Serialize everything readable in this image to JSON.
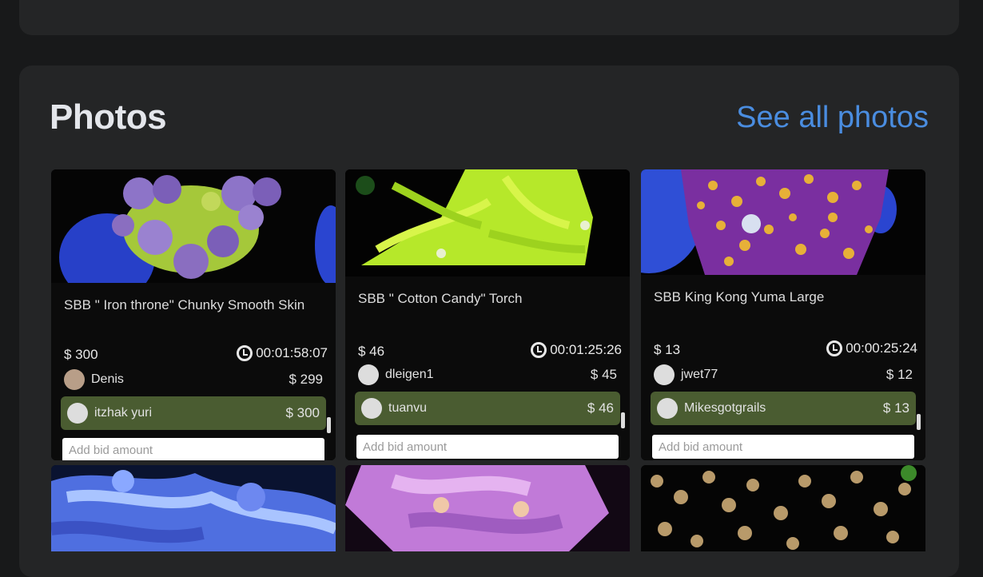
{
  "photos": {
    "title": "Photos",
    "see_all_label": "See all photos"
  },
  "listings": [
    {
      "title": "SBB \" Iron throne\" Chunky Smooth Skin",
      "price": "$ 300",
      "timer": "00:01:58:07",
      "prev_bidder": "Denis",
      "prev_bid": "$ 299",
      "top_bidder": "itzhak yuri",
      "top_bid": "$ 300",
      "bid_placeholder": "Add bid amount"
    },
    {
      "title": "SBB \" Cotton Candy\" Torch",
      "price": "$ 46",
      "timer": "00:01:25:26",
      "prev_bidder": "dleigen1",
      "prev_bid": "$ 45",
      "top_bidder": "tuanvu",
      "top_bid": "$ 46",
      "bid_placeholder": "Add bid amount"
    },
    {
      "title": "SBB King Kong Yuma Large",
      "price": "$ 13",
      "timer": "00:00:25:24",
      "prev_bidder": "jwet77",
      "prev_bid": "$ 12",
      "top_bidder": "Mikesgotgrails",
      "top_bid": "$ 13",
      "bid_placeholder": "Add bid amount"
    }
  ],
  "colors": {
    "background": "#18191a",
    "card": "#242526",
    "link": "#4a8de0",
    "winning_bid": "#4a5c31"
  }
}
